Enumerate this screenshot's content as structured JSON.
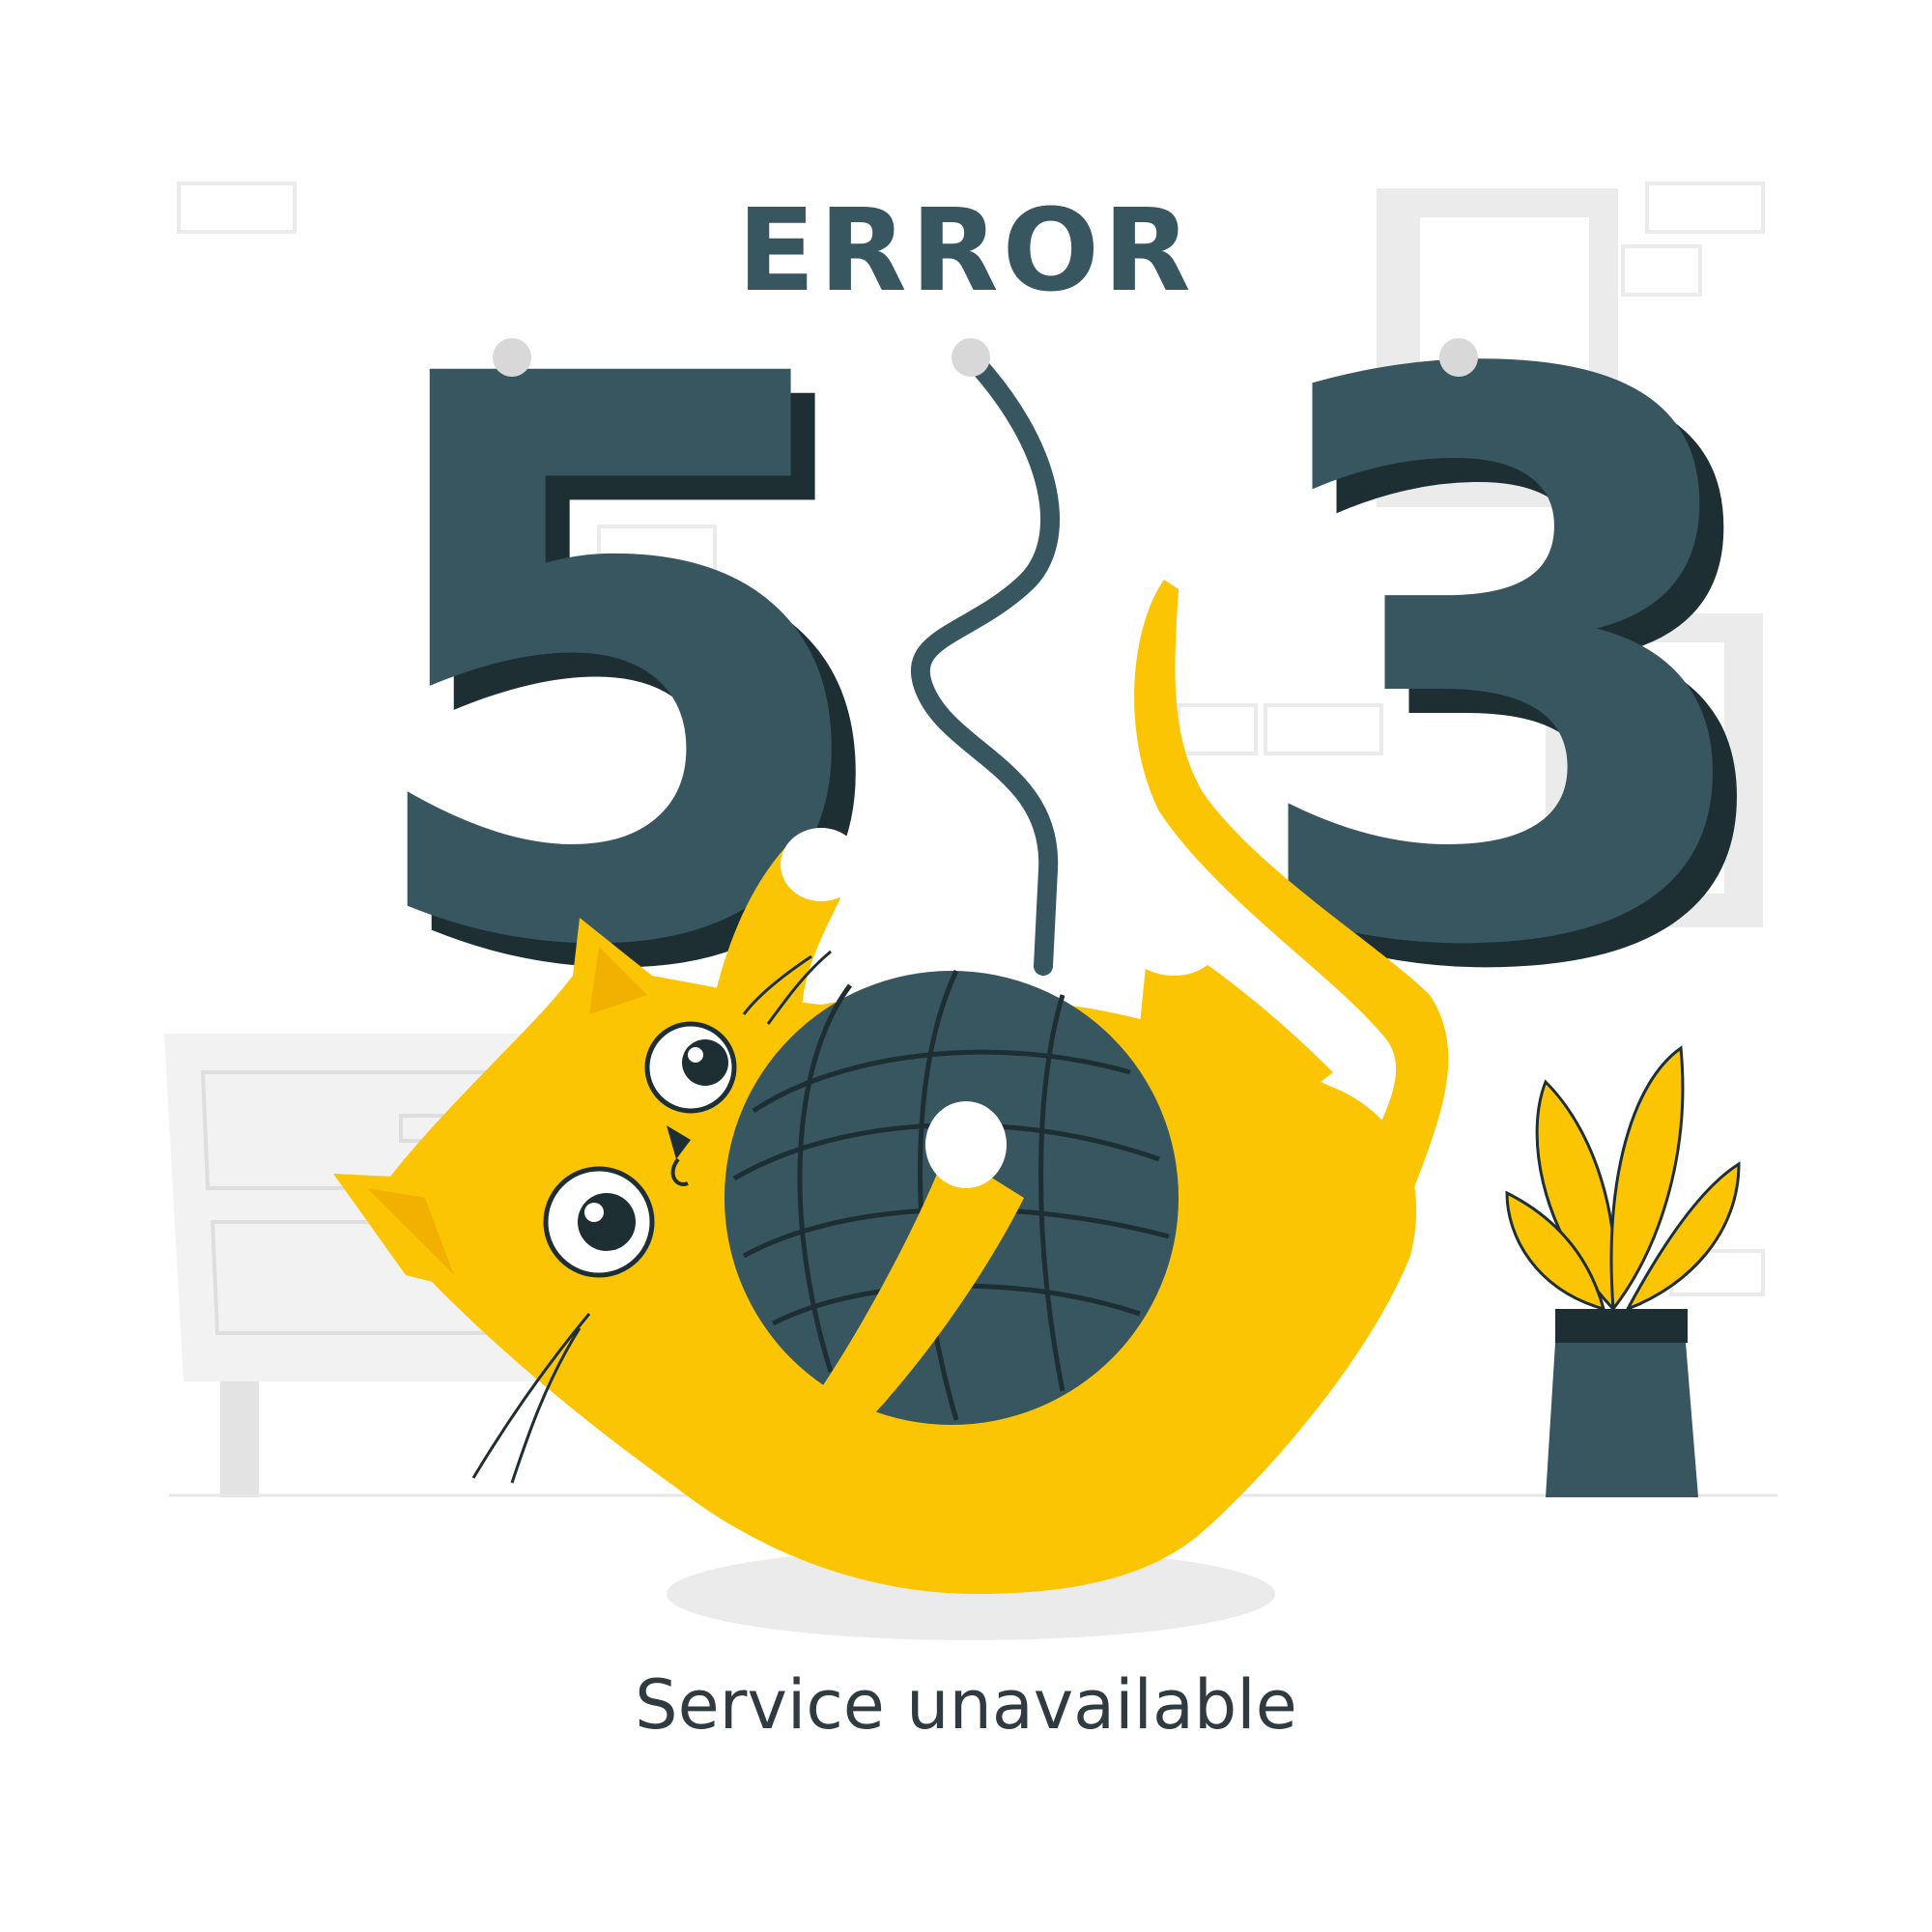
{
  "heading": "ERROR",
  "digits": {
    "left": "5",
    "right": "3"
  },
  "message": "Service unavailable",
  "colors": {
    "digit": "#37565f",
    "digit_shadow": "#1e2f34",
    "cat": "#fcc504",
    "cat_shade": "#f2b000",
    "yarn": "#37565f",
    "furniture": "#ebebeb",
    "pin": "#d8d8d8"
  }
}
